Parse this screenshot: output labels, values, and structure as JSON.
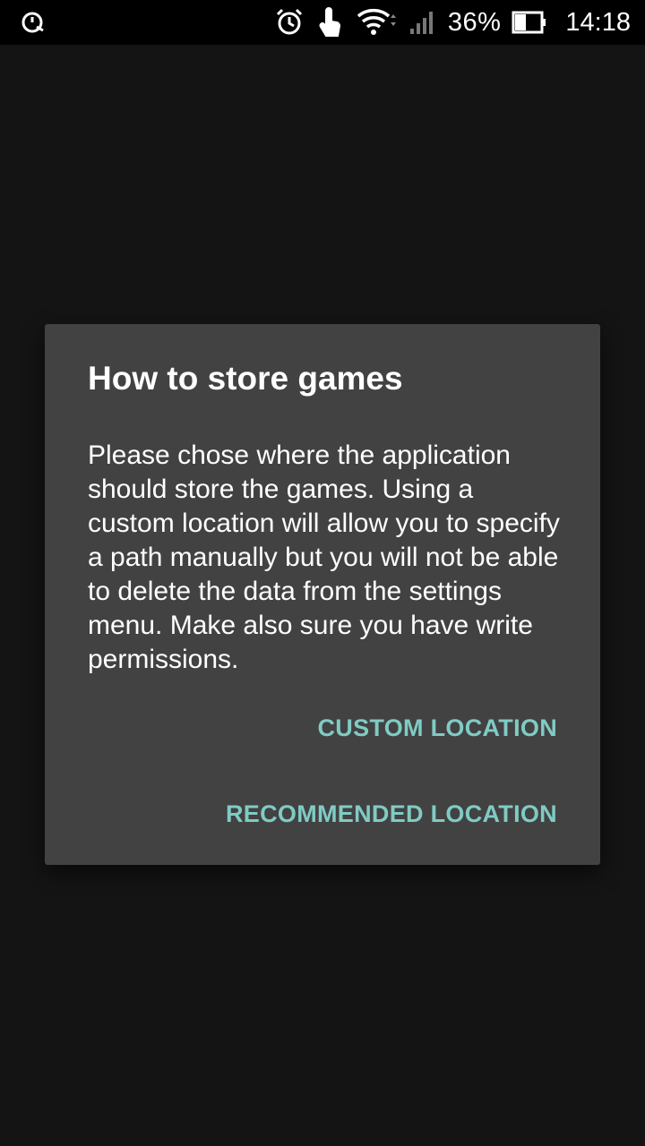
{
  "status_bar": {
    "left_icon": "data-saver-icon",
    "icons": [
      "alarm-icon",
      "touch-icon",
      "wifi-icon",
      "signal-icon",
      "battery-icon"
    ],
    "battery_percent": "36%",
    "time": "14:18"
  },
  "dialog": {
    "title": "How to store games",
    "message": "Please chose where the application should store the games. Using a custom location will allow you to specify a path manually but you will not be able to delete the data from the settings menu. Make also sure you have write permissions.",
    "buttons": {
      "custom_label": "CUSTOM LOCATION",
      "recommended_label": "RECOMMENDED LOCATION"
    }
  },
  "colors": {
    "background": "#141414",
    "dialog_background": "#424242",
    "accent": "#80cbc4",
    "text": "#ffffff"
  }
}
